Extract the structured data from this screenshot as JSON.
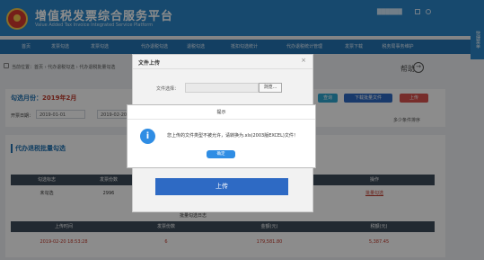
{
  "header": {
    "title": "增值税发票综合服务平台",
    "subtitle": "Value Added Tax Invoice Integrated Service Platform",
    "user_info": "██████"
  },
  "nav": {
    "items": [
      "首页",
      "发票勾选",
      "发票勾选",
      "代办退税勾选",
      "退税勾选",
      "抵扣勾选统计",
      "代办退税统计管理",
      "发票下载",
      "税务局事务维护"
    ]
  },
  "side_tab": "快捷菜单",
  "breadcrumb": "当前位置：首页 › 代办退税勾选 › 代办退税批量勾选",
  "help": {
    "label": "帮助"
  },
  "period": {
    "label": "勾选月份：",
    "value": "2019年2月"
  },
  "filters": {
    "date_label": "开票日期：",
    "date_from": "2019-01-01",
    "date_to": "2019-02-20",
    "sort_label": "多少条件排序"
  },
  "toolbar": {
    "query_label": "查询",
    "download_label": "下载批量文件",
    "upload_label": "上传",
    "query_color": "#2fa7cf",
    "download_color": "#2e6ac4",
    "upload_color": "#d9534f"
  },
  "section": {
    "title": "代办退税批量勾选",
    "columns": [
      "勾选标志",
      "发票份数",
      "",
      "",
      "操作"
    ],
    "row": [
      "未勾选",
      "2996",
      "",
      "",
      "批量勾选"
    ]
  },
  "stats": {
    "title": "批量勾选日志",
    "columns": [
      "上传时间",
      "发票份数",
      "金额(元)",
      "税额(元)"
    ],
    "row": [
      "2019-02-20 18:53:28",
      "6",
      "179,581.80",
      "5,387.45"
    ]
  },
  "upload_dialog": {
    "title": "文件上传",
    "close": "×",
    "file_label": "文件选择：",
    "browse_label": "浏览...",
    "upload_label": "上传"
  },
  "alert": {
    "title": "提示",
    "message": "您上传的文件类型不被允许，请转换为.xls(2003版EXCEL)文件！",
    "ok_label": "确定",
    "icon": "i"
  }
}
